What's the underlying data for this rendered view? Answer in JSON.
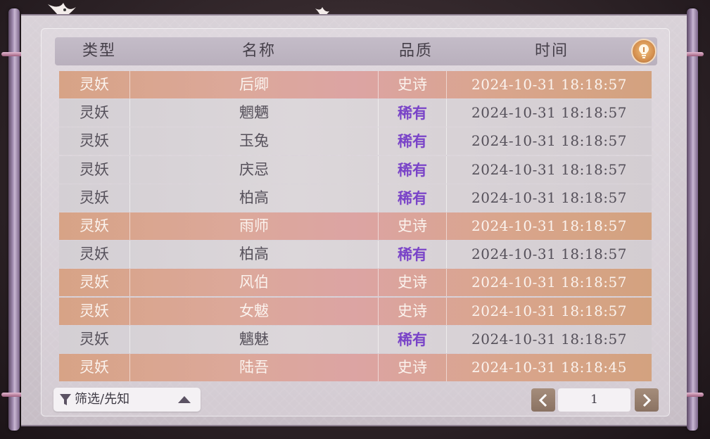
{
  "header": {
    "col_type": "类型",
    "col_name": "名称",
    "col_quality": "品质",
    "col_time": "时间"
  },
  "rows": [
    {
      "type": "灵妖",
      "name": "后卿",
      "quality": "史诗",
      "time": "2024-10-31  18:18:57",
      "tier": "epic"
    },
    {
      "type": "灵妖",
      "name": "魍魉",
      "quality": "稀有",
      "time": "2024-10-31  18:18:57",
      "tier": "rare"
    },
    {
      "type": "灵妖",
      "name": "玉兔",
      "quality": "稀有",
      "time": "2024-10-31  18:18:57",
      "tier": "rare"
    },
    {
      "type": "灵妖",
      "name": "庆忌",
      "quality": "稀有",
      "time": "2024-10-31  18:18:57",
      "tier": "rare"
    },
    {
      "type": "灵妖",
      "name": "柏高",
      "quality": "稀有",
      "time": "2024-10-31  18:18:57",
      "tier": "rare"
    },
    {
      "type": "灵妖",
      "name": "雨师",
      "quality": "史诗",
      "time": "2024-10-31  18:18:57",
      "tier": "epic"
    },
    {
      "type": "灵妖",
      "name": "柏高",
      "quality": "稀有",
      "time": "2024-10-31  18:18:57",
      "tier": "rare"
    },
    {
      "type": "灵妖",
      "name": "风伯",
      "quality": "史诗",
      "time": "2024-10-31  18:18:57",
      "tier": "epic"
    },
    {
      "type": "灵妖",
      "name": "女魃",
      "quality": "史诗",
      "time": "2024-10-31  18:18:57",
      "tier": "epic"
    },
    {
      "type": "灵妖",
      "name": "魑魅",
      "quality": "稀有",
      "time": "2024-10-31  18:18:57",
      "tier": "rare"
    },
    {
      "type": "灵妖",
      "name": "陆吾",
      "quality": "史诗",
      "time": "2024-10-31  18:18:45",
      "tier": "epic"
    }
  ],
  "filter": {
    "label": "筛选/先知",
    "icon": "filter-icon",
    "toggle_icon": "caret-up-icon"
  },
  "pager": {
    "current_page": "1",
    "prev_icon": "chevron-left-icon",
    "next_icon": "chevron-right-icon"
  },
  "hint_icon": "lightbulb-icon",
  "colors": {
    "epic_row": "#d9a58c",
    "rare_row": "#d6d1d5",
    "rare_quality_text": "#7a44c8",
    "header_bg": "#bfb6c2",
    "pager_button": "#977d6b"
  }
}
